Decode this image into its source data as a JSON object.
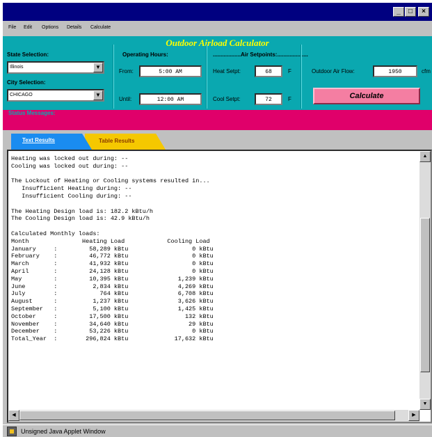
{
  "window": {
    "minimize": "_",
    "maximize": "□",
    "close": "×"
  },
  "menu": [
    "File",
    "Edit",
    "Options",
    "Details",
    "Calculate"
  ],
  "app_title": "Outdoor Airload Calculator",
  "state": {
    "label": "State Selection:",
    "value": "Illinois"
  },
  "city": {
    "label": "City Selection:",
    "value": "CHICAGO"
  },
  "hours": {
    "label": "Operating Hours:",
    "from_label": "From:",
    "from_value": "5:00 AM",
    "until_label": "Until:",
    "until_value": "12:00 AM"
  },
  "setpoints": {
    "label": "..................Air Setpoints:....................",
    "heat_label": "Heat Setpt:",
    "heat_value": "68",
    "heat_unit": "F",
    "cool_label": "Cool Setpt:",
    "cool_value": "72",
    "cool_unit": "F",
    "flow_label": "Outdoor Air Flow:",
    "flow_value": "1950",
    "flow_unit": "cfm"
  },
  "calculate_label": "Calculate",
  "status_label": "Status Messages:",
  "tabs": {
    "text_results": "Text Results",
    "table_results": "Table Results"
  },
  "results_text": "Heating was locked out during: --\nCooling was locked out during: --\n\nThe Lockout of Heating or Cooling systems resulted in...\n   Insufficient Heating during: --\n   Insufficient Cooling during: --\n\nThe Heating Design load is: 182.2 kBtu/h\nThe Cooling Design load is: 42.9 kBtu/h\n\nCalculated Monthly loads:\nMonth               Heating Load            Cooling Load\nJanuary     :         58,289 kBtu                  0 kBtu\nFebruary    :         46,772 kBtu                  0 kBtu\nMarch       :         41,932 kBtu                  0 kBtu\nApril       :         24,128 kBtu                  0 kBtu\nMay         :         10,395 kBtu              1,239 kBtu\nJune        :          2,834 kBtu              4,269 kBtu\nJuly        :            764 kBtu              6,708 kBtu\nAugust      :          1,237 kBtu              3,626 kBtu\nSeptember   :          5,100 kBtu              1,425 kBtu\nOctober     :         17,500 kBtu                132 kBtu\nNovember    :         34,640 kBtu                 29 kBtu\nDecember    :         53,226 kBtu                  0 kBtu\nTotal_Year  :        296,824 kBtu             17,632 kBtu",
  "statusbar_text": "Unsigned Java Applet Window",
  "colors": {
    "panel": "#0aa8b0",
    "title": "#ffff00",
    "status_strip": "#e0006a",
    "calc_button": "#f47ea2",
    "tab_active": "#1a8cf0",
    "tab_inactive": "#f5c800"
  }
}
